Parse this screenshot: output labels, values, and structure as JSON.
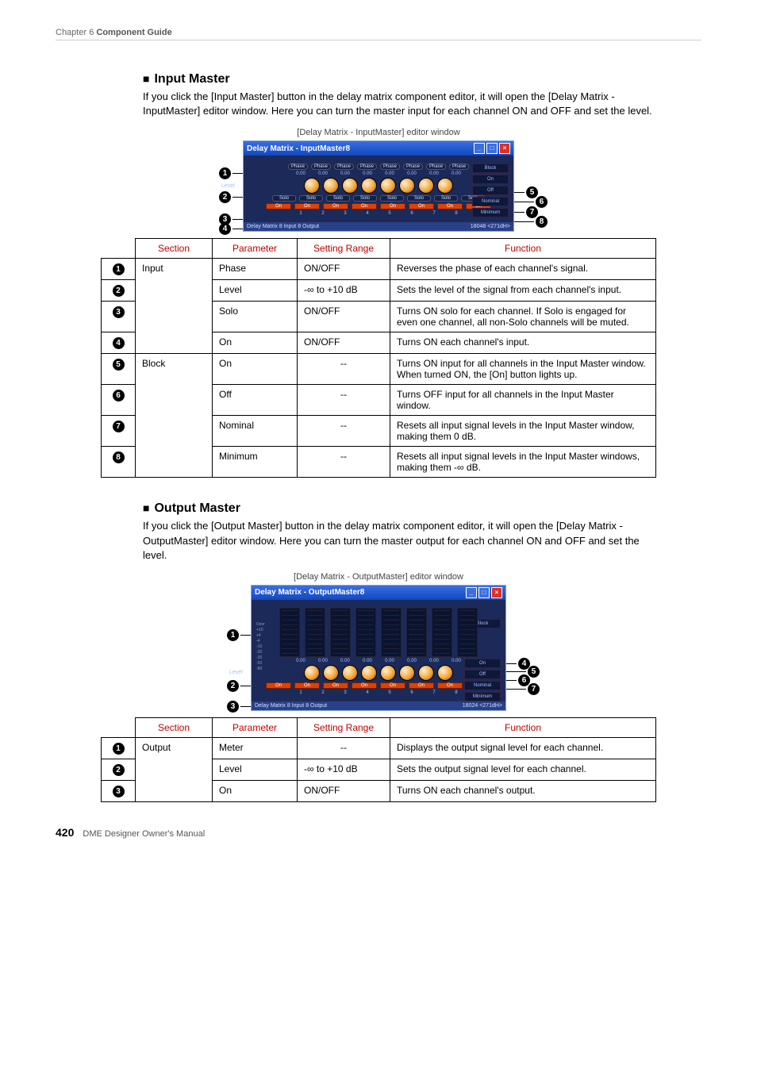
{
  "chapter": {
    "prefix": "Chapter 6  ",
    "title": "Component Guide"
  },
  "section1": {
    "heading": "Input Master",
    "body": "If you click the [Input Master] button in the delay matrix component editor, it will open the [Delay Matrix - InputMaster] editor window. Here you can turn the master input for each channel ON and OFF and set the level.",
    "caption": "[Delay Matrix - InputMaster] editor window",
    "window_title": "Delay Matrix - InputMaster8",
    "row_labels": {
      "level": "Level",
      "phase": "Phase",
      "val": "0.00",
      "solo": "Solo",
      "on": "On"
    },
    "block": {
      "title": "Block",
      "on": "On",
      "off": "Off",
      "nom": "Nominal",
      "min": "Minimum"
    },
    "status_left": "Delay Matrix  8 Input 8 Output",
    "status_right": "18048 <271dH>"
  },
  "table1": {
    "headers": [
      "Section",
      "Parameter",
      "Setting Range",
      "Function"
    ],
    "rows": [
      {
        "n": "1",
        "sec": "Input",
        "par": "Phase",
        "rng": "ON/OFF",
        "fn": "Reverses the phase of each channel's signal."
      },
      {
        "n": "2",
        "sec": "",
        "par": "Level",
        "rng": "-∞ to +10 dB",
        "fn": "Sets the level of the signal from each channel's input."
      },
      {
        "n": "3",
        "sec": "",
        "par": "Solo",
        "rng": "ON/OFF",
        "fn": "Turns ON solo for each channel. If Solo is engaged for even one channel, all non-Solo channels will be muted."
      },
      {
        "n": "4",
        "sec": "",
        "par": "On",
        "rng": "ON/OFF",
        "fn": "Turns ON each channel's input."
      },
      {
        "n": "5",
        "sec": "Block",
        "par": "On",
        "rng": "--",
        "fn": "Turns ON input for all channels in the Input Master window. When turned ON, the [On] button lights up."
      },
      {
        "n": "6",
        "sec": "",
        "par": "Off",
        "rng": "--",
        "fn": "Turns OFF input for all channels in the Input Master window."
      },
      {
        "n": "7",
        "sec": "",
        "par": "Nominal",
        "rng": "--",
        "fn": "Resets all input signal levels in the Input Master window, making them 0 dB."
      },
      {
        "n": "8",
        "sec": "",
        "par": "Minimum",
        "rng": "--",
        "fn": "Resets all input signal levels in the Input Master windows, making them -∞ dB."
      }
    ]
  },
  "section2": {
    "heading": "Output Master",
    "body": "If you click the [Output Master] button in the delay matrix component editor, it will open the [Delay Matrix - OutputMaster] editor window. Here you can turn the master output for each channel ON and OFF and set the level.",
    "caption": "[Delay Matrix - OutputMaster] editor window",
    "window_title": "Delay Matrix - OutputMaster8",
    "row_labels": {
      "over": "Over",
      "level": "Level",
      "on": "On",
      "val": "0.00"
    },
    "block": {
      "title": "Block",
      "on": "On",
      "off": "Off",
      "nom": "Nominal",
      "min": "Minimum"
    },
    "status_left": "Delay Matrix  8 Input 8 Output",
    "status_right": "18024 <271dH>"
  },
  "table2": {
    "headers": [
      "Section",
      "Parameter",
      "Setting Range",
      "Function"
    ],
    "rows": [
      {
        "n": "1",
        "sec": "Output",
        "par": "Meter",
        "rng": "--",
        "fn": "Displays the output signal level for each channel."
      },
      {
        "n": "2",
        "sec": "",
        "par": "Level",
        "rng": "-∞ to +10 dB",
        "fn": "Sets the output signal level for each channel."
      },
      {
        "n": "3",
        "sec": "",
        "par": "On",
        "rng": "ON/OFF",
        "fn": "Turns ON each channel's output."
      }
    ]
  },
  "footer": {
    "page": "420",
    "manual": "DME Designer Owner's Manual"
  }
}
